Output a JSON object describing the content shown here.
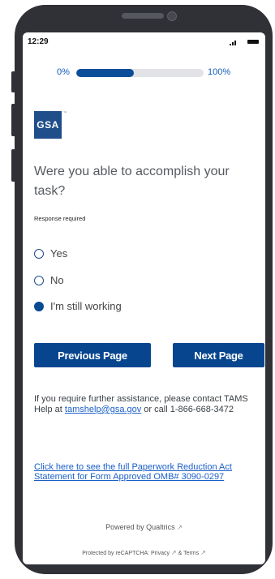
{
  "status_bar": {
    "time": "12:29"
  },
  "progress": {
    "min_label": "0%",
    "max_label": "100%",
    "value_percent": 45
  },
  "logo": {
    "text": "GSA"
  },
  "question": {
    "text": "Were you able to accomplish your task?",
    "required_note": "Response required"
  },
  "options": [
    {
      "label": "Yes",
      "selected": false
    },
    {
      "label": "No",
      "selected": false
    },
    {
      "label": "I'm still working",
      "selected": true
    }
  ],
  "buttons": {
    "previous": "Previous Page",
    "next": "Next Page"
  },
  "help": {
    "prefix": "If you require further assistance, please contact TAMS Help at ",
    "email": "tamshelp@gsa.gov",
    "suffix": " or call 1-866-668-3472"
  },
  "paperwork_link": "Click here to see the full Paperwork Reduction Act Statement for Form Approved OMB# 3090-0297",
  "footer": {
    "powered_by": "Powered by Qualtrics",
    "recaptcha_prefix": "Protected by reCAPTCHA: ",
    "privacy": "Privacy",
    "amp": " & ",
    "terms": "Terms"
  }
}
